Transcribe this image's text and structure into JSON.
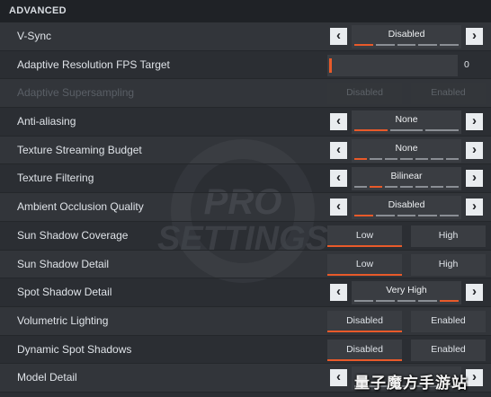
{
  "header": {
    "title": "ADVANCED"
  },
  "watermark": {
    "line1": "PRO",
    "line2": "SETTINGS"
  },
  "site_watermark": "量子魔方手游站",
  "colors": {
    "accent": "#e85a2a",
    "background": "#2b2e33"
  },
  "rows": [
    {
      "label": "V-Sync",
      "kind": "selector",
      "value": "Disabled",
      "segments": 5,
      "active_segment": 1
    },
    {
      "label": "Adaptive Resolution FPS Target",
      "kind": "slider",
      "value": "0",
      "level_fraction": 0.0
    },
    {
      "label": "Adaptive Supersampling",
      "kind": "toggle",
      "disabled": true,
      "options": [
        "Disabled",
        "Enabled"
      ],
      "selected": 0
    },
    {
      "label": "Anti-aliasing",
      "kind": "selector",
      "value": "None",
      "segments": 3,
      "active_segment": 1
    },
    {
      "label": "Texture Streaming Budget",
      "kind": "selector",
      "value": "None",
      "segments": 7,
      "active_segment": 1
    },
    {
      "label": "Texture Filtering",
      "kind": "selector",
      "value": "Bilinear",
      "segments": 7,
      "active_segment": 2
    },
    {
      "label": "Ambient Occlusion Quality",
      "kind": "selector",
      "value": "Disabled",
      "segments": 5,
      "active_segment": 1
    },
    {
      "label": "Sun Shadow Coverage",
      "kind": "toggle",
      "options": [
        "Low",
        "High"
      ],
      "selected": 0
    },
    {
      "label": "Sun Shadow Detail",
      "kind": "toggle",
      "options": [
        "Low",
        "High"
      ],
      "selected": 0
    },
    {
      "label": "Spot Shadow Detail",
      "kind": "selector",
      "value": "Very High",
      "segments": 5,
      "active_segment": 5
    },
    {
      "label": "Volumetric Lighting",
      "kind": "toggle",
      "options": [
        "Disabled",
        "Enabled"
      ],
      "selected": 0
    },
    {
      "label": "Dynamic Spot Shadows",
      "kind": "toggle",
      "options": [
        "Disabled",
        "Enabled"
      ],
      "selected": 0
    },
    {
      "label": "Model Detail",
      "kind": "selector",
      "value": "",
      "segments": 3,
      "active_segment": 0
    }
  ]
}
